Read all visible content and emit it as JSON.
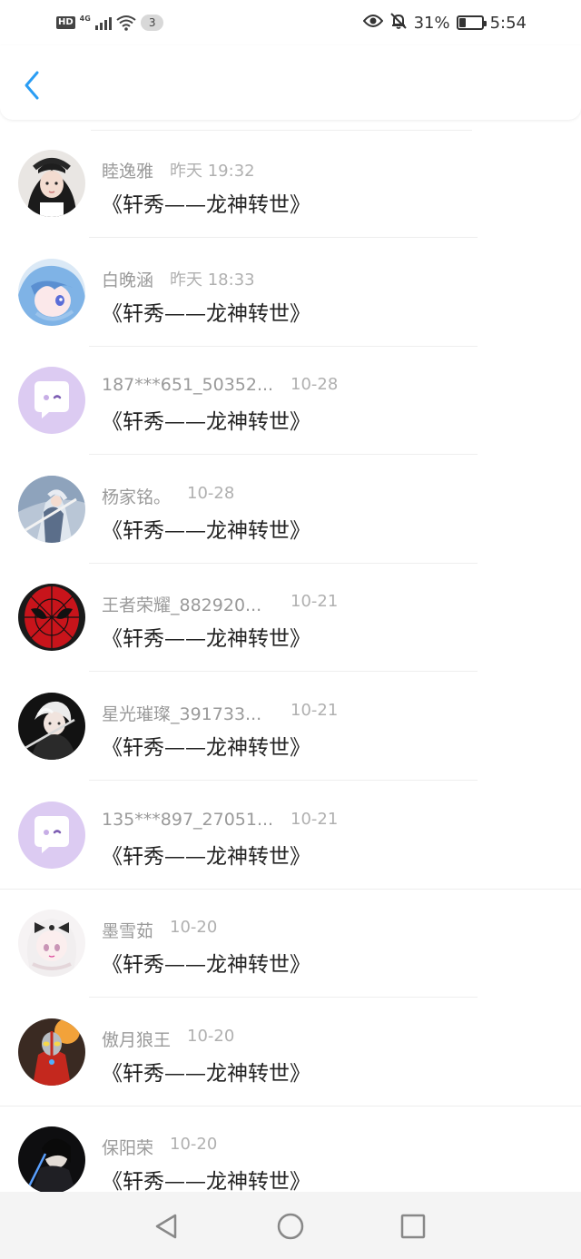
{
  "status_bar": {
    "hd": "HD",
    "network": "4G",
    "notification_count": "3",
    "battery_percent": "31%",
    "battery_level": 0.31,
    "time": "5:54",
    "icons": [
      "eye-icon",
      "bell-off-icon",
      "battery-icon",
      "wifi-icon",
      "signal-icon"
    ]
  },
  "header": {
    "back_icon": "chevron-left-icon",
    "accent_color": "#2a9df4"
  },
  "items": [
    {
      "name": "睦逸雅",
      "time": "昨天 19:32",
      "message": "《轩秀——龙神转世》",
      "avatar": "girl-photo-avatar"
    },
    {
      "name": "白晚涵",
      "time": "昨天 18:33",
      "message": "《轩秀——龙神转世》",
      "avatar": "anime-blue-hair-avatar"
    },
    {
      "name": "187***651_50352...",
      "time": "10-28",
      "message": "《轩秀——龙神转世》",
      "avatar": "default-chat-avatar"
    },
    {
      "name": "杨家铭。",
      "time": "10-28",
      "message": "《轩秀——龙神转世》",
      "avatar": "anime-knight-avatar"
    },
    {
      "name": "王者荣耀_882920...",
      "time": "10-21",
      "message": "《轩秀——龙神转世》",
      "avatar": "spiderman-avatar"
    },
    {
      "name": "星光璀璨_391733...",
      "time": "10-21",
      "message": "《轩秀——龙神转世》",
      "avatar": "anime-white-hair-avatar"
    },
    {
      "name": "135***897_27051...",
      "time": "10-21",
      "message": "《轩秀——龙神转世》",
      "avatar": "default-chat-avatar"
    },
    {
      "name": "墨雪茹",
      "time": "10-20",
      "message": "《轩秀——龙神转世》",
      "avatar": "anime-girl-bow-avatar"
    },
    {
      "name": "傲月狼王",
      "time": "10-20",
      "message": "《轩秀——龙神转世》",
      "avatar": "ultraman-avatar"
    },
    {
      "name": "保阳荣",
      "time": "10-20",
      "message": "《轩秀——龙神转世》",
      "avatar": "dark-figure-avatar"
    }
  ],
  "navbar": {
    "icons": [
      "back-triangle-icon",
      "home-circle-icon",
      "recents-square-icon"
    ]
  }
}
